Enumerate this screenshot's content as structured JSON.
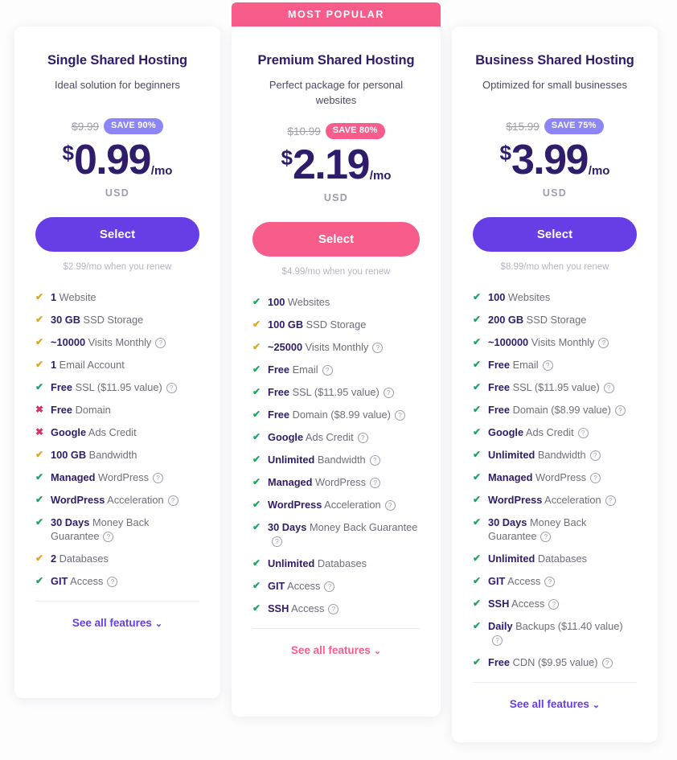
{
  "ribbon": {
    "label": "MOST POPULAR"
  },
  "icons": {
    "check": "✔",
    "cross": "✖",
    "help": "?",
    "chevron_down": "⌄"
  },
  "colors": {
    "purple": "#673de6",
    "badge_purple": "#8c85f7",
    "pink": "#f75c8b",
    "heading": "#2f1c6a",
    "check_green": "#21a366",
    "check_amber": "#daa520",
    "cross_red": "#d93267"
  },
  "plans": [
    {
      "name": "Single Shared Hosting",
      "description": "Ideal solution for beginners",
      "old_price": "$9.99",
      "save_badge": "SAVE 90%",
      "currency_symbol": "$",
      "price": "0.99",
      "per": "/mo",
      "currency_code": "USD",
      "cta": "Select",
      "renewal": "$2.99/mo when you renew",
      "see_all": "See all features",
      "features": [
        {
          "icon": "check",
          "tone": "amber",
          "strong": "1",
          "rest": " Website",
          "help": false
        },
        {
          "icon": "check",
          "tone": "amber",
          "strong": "30 GB",
          "rest": " SSD Storage",
          "help": false
        },
        {
          "icon": "check",
          "tone": "amber",
          "strong": "~10000",
          "rest": " Visits Monthly",
          "help": true
        },
        {
          "icon": "check",
          "tone": "amber",
          "strong": "1",
          "rest": " Email Account",
          "help": false
        },
        {
          "icon": "check",
          "tone": "green",
          "strong": "Free",
          "rest": " SSL ($11.95 value)",
          "help": true
        },
        {
          "icon": "cross",
          "tone": "red",
          "strong": "Free",
          "rest": " Domain",
          "help": false
        },
        {
          "icon": "cross",
          "tone": "red",
          "strong": "Google",
          "rest": " Ads Credit",
          "help": false
        },
        {
          "icon": "check",
          "tone": "amber",
          "strong": "100 GB",
          "rest": " Bandwidth",
          "help": false
        },
        {
          "icon": "check",
          "tone": "green",
          "strong": "Managed",
          "rest": " WordPress",
          "help": true
        },
        {
          "icon": "check",
          "tone": "green",
          "strong": "WordPress",
          "rest": " Acceleration",
          "help": true
        },
        {
          "icon": "check",
          "tone": "green",
          "strong": "30 Days",
          "rest": " Money Back Guarantee",
          "help": true
        },
        {
          "icon": "check",
          "tone": "amber",
          "strong": "2",
          "rest": " Databases",
          "help": false
        },
        {
          "icon": "check",
          "tone": "green",
          "strong": "GIT",
          "rest": " Access",
          "help": true
        }
      ]
    },
    {
      "name": "Premium Shared Hosting",
      "description": "Perfect package for personal websites",
      "old_price": "$10.99",
      "save_badge": "SAVE 80%",
      "currency_symbol": "$",
      "price": "2.19",
      "per": "/mo",
      "currency_code": "USD",
      "cta": "Select",
      "renewal": "$4.99/mo when you renew",
      "see_all": "See all features",
      "features": [
        {
          "icon": "check",
          "tone": "green",
          "strong": "100",
          "rest": " Websites",
          "help": false
        },
        {
          "icon": "check",
          "tone": "amber",
          "strong": "100 GB",
          "rest": " SSD Storage",
          "help": false
        },
        {
          "icon": "check",
          "tone": "amber",
          "strong": "~25000",
          "rest": " Visits Monthly",
          "help": true
        },
        {
          "icon": "check",
          "tone": "green",
          "strong": "Free",
          "rest": " Email",
          "help": true
        },
        {
          "icon": "check",
          "tone": "green",
          "strong": "Free",
          "rest": " SSL ($11.95 value)",
          "help": true
        },
        {
          "icon": "check",
          "tone": "green",
          "strong": "Free",
          "rest": " Domain ($8.99 value)",
          "help": true
        },
        {
          "icon": "check",
          "tone": "green",
          "strong": "Google",
          "rest": " Ads Credit",
          "help": true
        },
        {
          "icon": "check",
          "tone": "green",
          "strong": "Unlimited",
          "rest": " Bandwidth",
          "help": true
        },
        {
          "icon": "check",
          "tone": "green",
          "strong": "Managed",
          "rest": " WordPress",
          "help": true
        },
        {
          "icon": "check",
          "tone": "green",
          "strong": "WordPress",
          "rest": " Acceleration",
          "help": true
        },
        {
          "icon": "check",
          "tone": "green",
          "strong": "30 Days",
          "rest": " Money Back Guarantee",
          "help": true
        },
        {
          "icon": "check",
          "tone": "green",
          "strong": "Unlimited",
          "rest": " Databases",
          "help": false
        },
        {
          "icon": "check",
          "tone": "green",
          "strong": "GIT",
          "rest": " Access",
          "help": true
        },
        {
          "icon": "check",
          "tone": "green",
          "strong": "SSH",
          "rest": " Access",
          "help": true
        }
      ]
    },
    {
      "name": "Business Shared Hosting",
      "description": "Optimized for small businesses",
      "old_price": "$15.99",
      "save_badge": "SAVE 75%",
      "currency_symbol": "$",
      "price": "3.99",
      "per": "/mo",
      "currency_code": "USD",
      "cta": "Select",
      "renewal": "$8.99/mo when you renew",
      "see_all": "See all features",
      "features": [
        {
          "icon": "check",
          "tone": "green",
          "strong": "100",
          "rest": " Websites",
          "help": false
        },
        {
          "icon": "check",
          "tone": "green",
          "strong": "200 GB",
          "rest": " SSD Storage",
          "help": false
        },
        {
          "icon": "check",
          "tone": "green",
          "strong": "~100000",
          "rest": " Visits Monthly",
          "help": true
        },
        {
          "icon": "check",
          "tone": "green",
          "strong": "Free",
          "rest": " Email",
          "help": true
        },
        {
          "icon": "check",
          "tone": "green",
          "strong": "Free",
          "rest": " SSL ($11.95 value)",
          "help": true
        },
        {
          "icon": "check",
          "tone": "green",
          "strong": "Free",
          "rest": " Domain ($8.99 value)",
          "help": true
        },
        {
          "icon": "check",
          "tone": "green",
          "strong": "Google",
          "rest": " Ads Credit",
          "help": true
        },
        {
          "icon": "check",
          "tone": "green",
          "strong": "Unlimited",
          "rest": " Bandwidth",
          "help": true
        },
        {
          "icon": "check",
          "tone": "green",
          "strong": "Managed",
          "rest": " WordPress",
          "help": true
        },
        {
          "icon": "check",
          "tone": "green",
          "strong": "WordPress",
          "rest": " Acceleration",
          "help": true
        },
        {
          "icon": "check",
          "tone": "green",
          "strong": "30 Days",
          "rest": " Money Back Guarantee",
          "help": true
        },
        {
          "icon": "check",
          "tone": "green",
          "strong": "Unlimited",
          "rest": " Databases",
          "help": false
        },
        {
          "icon": "check",
          "tone": "green",
          "strong": "GIT",
          "rest": " Access",
          "help": true
        },
        {
          "icon": "check",
          "tone": "green",
          "strong": "SSH",
          "rest": " Access",
          "help": true
        },
        {
          "icon": "check",
          "tone": "green",
          "strong": "Daily",
          "rest": " Backups ($11.40 value)",
          "help": true
        },
        {
          "icon": "check",
          "tone": "green",
          "strong": "Free",
          "rest": " CDN ($9.95 value)",
          "help": true
        }
      ]
    }
  ]
}
